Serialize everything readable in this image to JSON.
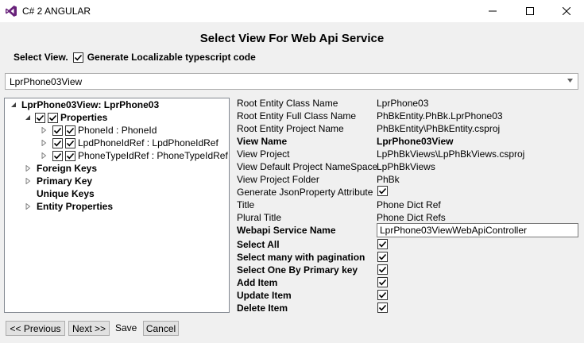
{
  "window": {
    "title": "C# 2 ANGULAR",
    "brand_color": "#68217a"
  },
  "heading": "Select View For Web Api Service",
  "select_view_label": "Select View.",
  "localizable_checkbox": {
    "label": "Generate Localizable typescript code",
    "checked": true
  },
  "view_dropdown": {
    "selected": "LprPhone03View"
  },
  "tree": {
    "root": "LprPhone03View: LprPhone03",
    "properties": "Properties",
    "property_items": [
      "PhoneId : PhoneId",
      "LpdPhoneIdRef : LpdPhoneIdRef",
      "PhoneTypeIdRef : PhoneTypeIdRef"
    ],
    "foreign_keys": "Foreign Keys",
    "primary_key": "Primary Key",
    "unique_keys": "Unique Keys",
    "entity_properties": "Entity Properties"
  },
  "details": {
    "root_entity_class_name": {
      "label": "Root Entity Class Name",
      "value": "LprPhone03"
    },
    "root_entity_full_class_name": {
      "label": "Root Entity Full Class Name",
      "value": "PhBkEntity.PhBk.LprPhone03"
    },
    "root_entity_project_name": {
      "label": "Root Entity Project Name",
      "value": "PhBkEntity\\PhBkEntity.csproj"
    },
    "view_name": {
      "label": "View Name",
      "value": "LprPhone03View"
    },
    "view_project": {
      "label": "View Project",
      "value": "LpPhBkViews\\LpPhBkViews.csproj"
    },
    "view_default_namespace": {
      "label": "View Default Project NameSpace",
      "value": "LpPhBkViews"
    },
    "view_project_folder": {
      "label": "View Project Folder",
      "value": "PhBk"
    },
    "generate_json_property": {
      "label": "Generate JsonProperty Attribute",
      "checked": true
    },
    "title": {
      "label": "Title",
      "value": "Phone Dict Ref"
    },
    "plural_title": {
      "label": "Plural Title",
      "value": "Phone Dict Refs"
    },
    "webapi_service_name": {
      "label": "Webapi Service Name",
      "value": "LprPhone03ViewWebApiController"
    },
    "select_all": {
      "label": "Select All",
      "checked": true
    },
    "select_many": {
      "label": "Select many with pagination",
      "checked": true
    },
    "select_one": {
      "label": "Select One By Primary key",
      "checked": true
    },
    "add_item": {
      "label": "Add Item",
      "checked": true
    },
    "update_item": {
      "label": "Update Item",
      "checked": true
    },
    "delete_item": {
      "label": "Delete Item",
      "checked": true
    }
  },
  "footer": {
    "previous": "<< Previous",
    "next": "Next >>",
    "save": "Save",
    "cancel": "Cancel"
  }
}
